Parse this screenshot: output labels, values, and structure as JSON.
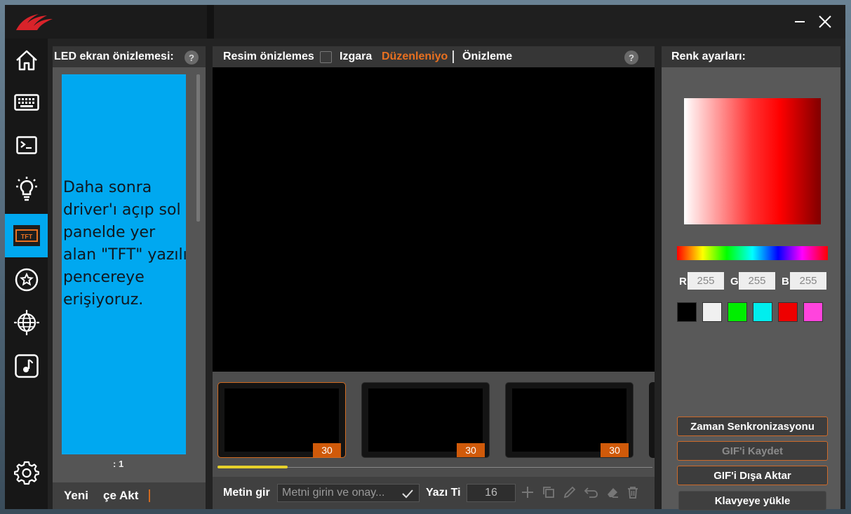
{
  "window": {
    "minimize_icon": "minimize-icon",
    "close_icon": "close-icon"
  },
  "sidebar": {
    "items": [
      {
        "icon": "home-icon"
      },
      {
        "icon": "keyboard-icon"
      },
      {
        "icon": "terminal-icon"
      },
      {
        "icon": "lightbulb-icon"
      },
      {
        "icon": "tft-icon",
        "label": "TFT",
        "active": true
      },
      {
        "icon": "star-circle-icon"
      },
      {
        "icon": "globe-icon"
      },
      {
        "icon": "music-icon"
      }
    ],
    "settings_icon": "gear-icon"
  },
  "left_panel": {
    "title": "LED ekran önizlemesi:",
    "help": "?",
    "preview_text": "Daha sonra driver'ı açıp sol panelde yer alan \"TFT\" yazılı pencereye erişiyoruz.",
    "ratio": ": 1",
    "new_label": "Yeni",
    "activate_label": "çe Akt"
  },
  "center_panel": {
    "tab_image_preview": "Resim önizlemes",
    "tab_grid": "Izgara",
    "tab_edit": "Düzenleniyo",
    "tab_preview": "Önizleme",
    "help": "?",
    "frames": [
      {
        "duration": "30",
        "selected": true
      },
      {
        "duration": "30",
        "selected": false
      },
      {
        "duration": "30",
        "selected": false
      }
    ],
    "text_label": "Metin gir",
    "text_placeholder": "Metni girin ve onay...",
    "font_size_label": "Yazı Ti",
    "font_size_value": "16"
  },
  "right_panel": {
    "title": "Renk ayarları:",
    "r_label": "R",
    "g_label": "G",
    "b_label": "B",
    "r_value": "255",
    "g_value": "255",
    "b_value": "255",
    "swatches": [
      "#000000",
      "#f0f0f0",
      "#00ee00",
      "#00eeee",
      "#ee0000",
      "#ff44dd"
    ],
    "time_sync": "Zaman Senkronizasyonu",
    "save_gif": "GIF'i Kaydet",
    "export_gif": "GIF'i Dışa Aktar",
    "upload_keyboard": "Klavyeye yükle"
  },
  "colors": {
    "accent_blue": "#00a8f0",
    "accent_orange": "#d05a0a",
    "edit_tab": "#e87020",
    "timeline_thumb": "#e6d12a"
  }
}
